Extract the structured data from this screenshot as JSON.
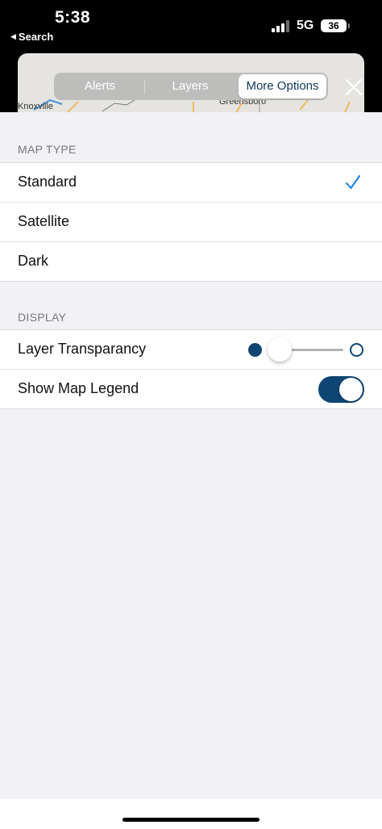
{
  "status_bar": {
    "time": "5:38",
    "back_label": "Search",
    "network": "5G",
    "battery": "36"
  },
  "map": {
    "labels": [
      "Knoxville",
      "Greensboro"
    ]
  },
  "tabs": [
    {
      "label": "Alerts",
      "selected": false
    },
    {
      "label": "Layers",
      "selected": false
    },
    {
      "label": "More Options",
      "selected": true
    }
  ],
  "map_type": {
    "header": "MAP TYPE",
    "options": [
      {
        "label": "Standard",
        "selected": true
      },
      {
        "label": "Satellite",
        "selected": false
      },
      {
        "label": "Dark",
        "selected": false
      }
    ]
  },
  "display": {
    "header": "DISPLAY",
    "layer_transparency_label": "Layer Transparancy",
    "layer_transparency_value": 0.25,
    "show_legend_label": "Show Map Legend",
    "show_legend_on": true
  },
  "colors": {
    "accent": "#0f4572",
    "checkmark": "#1a7fe0",
    "selected_tab_text": "#11365b"
  },
  "icons": {
    "close": "close-icon",
    "check": "checkmark-icon",
    "back": "back-triangle-icon"
  }
}
